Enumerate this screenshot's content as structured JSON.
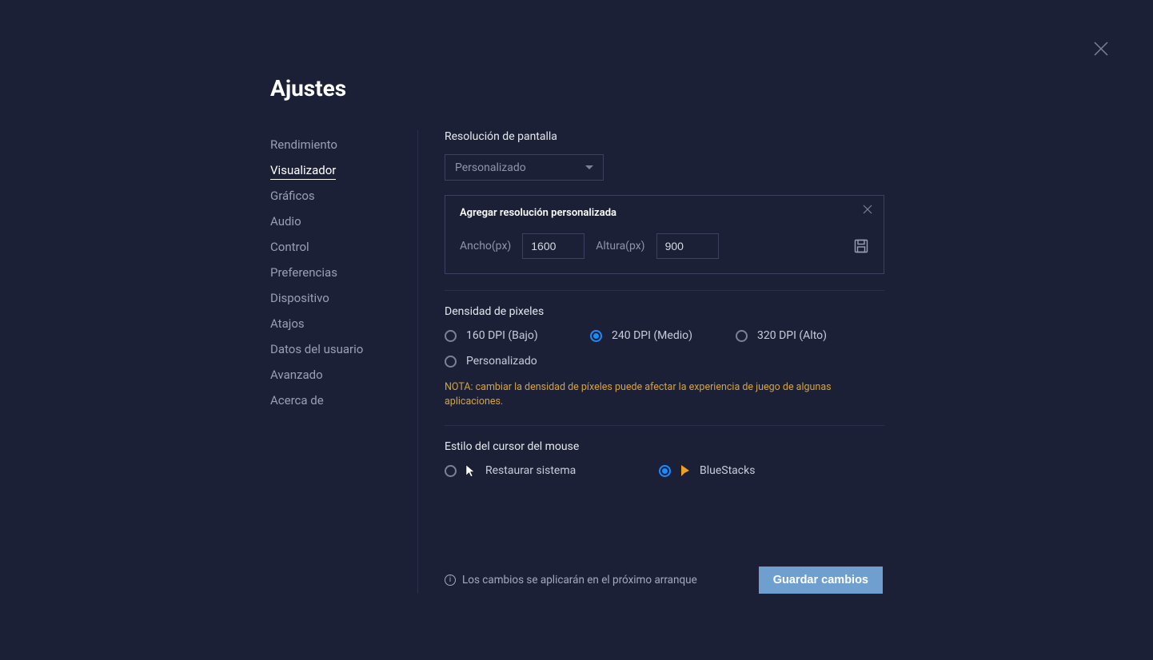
{
  "title": "Ajustes",
  "sidebar": {
    "items": [
      "Rendimiento",
      "Visualizador",
      "Gráficos",
      "Audio",
      "Control",
      "Preferencias",
      "Dispositivo",
      "Atajos",
      "Datos del usuario",
      "Avanzado",
      "Acerca de"
    ],
    "active": "Visualizador"
  },
  "resolution": {
    "title": "Resolución de pantalla",
    "selected": "Personalizado",
    "custom": {
      "title": "Agregar resolución personalizada",
      "width_label": "Ancho(px)",
      "width_value": "1600",
      "height_label": "Altura(px)",
      "height_value": "900"
    }
  },
  "density": {
    "title": "Densidad de pixeles",
    "options": [
      "160 DPI (Bajo)",
      "240 DPI (Medio)",
      "320 DPI (Alto)",
      "Personalizado"
    ],
    "selected": "240 DPI (Medio)",
    "note": "NOTA: cambiar la densidad de píxeles puede afectar la experiencia de juego de algunas aplicaciones."
  },
  "cursor": {
    "title": "Estilo del cursor del mouse",
    "options": [
      "Restaurar sistema",
      "BlueStacks"
    ],
    "selected": "BlueStacks"
  },
  "footer": {
    "restart_note": "Los cambios se aplicarán en el próximo arranque",
    "save_label": "Guardar cambios"
  }
}
